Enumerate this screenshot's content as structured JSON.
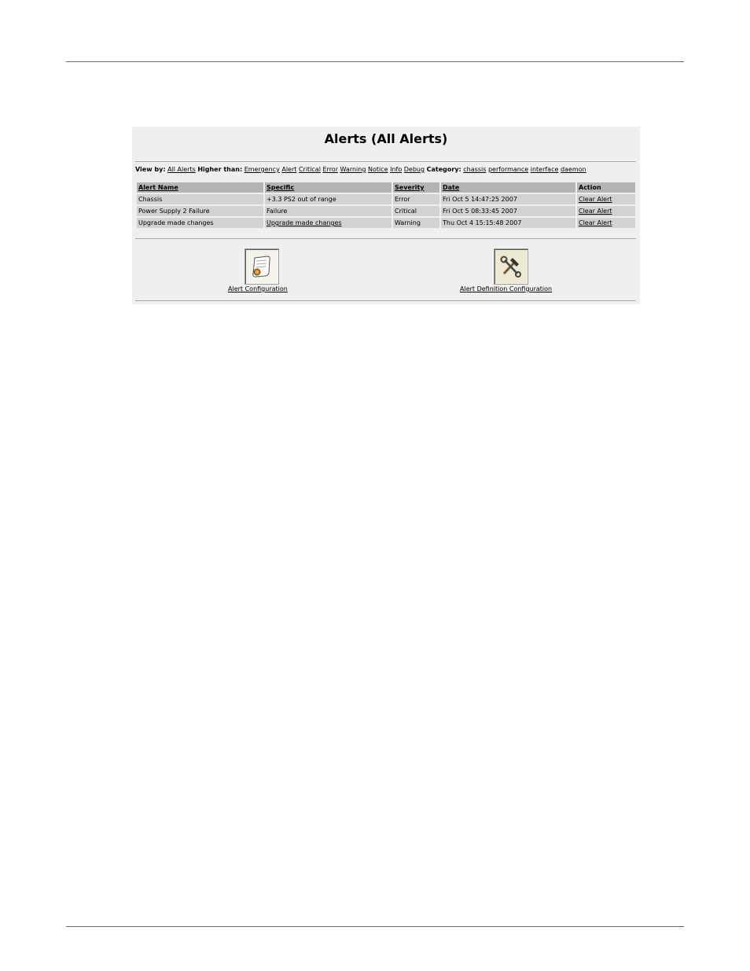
{
  "title": "Alerts (All Alerts)",
  "filters": {
    "view_by_label": "View by:",
    "view_by_all": "All Alerts",
    "higher_than_label": "Higher than:",
    "severities": [
      "Emergency",
      "Alert",
      "Critical",
      "Error",
      "Warning",
      "Notice",
      "Info",
      "Debug"
    ],
    "category_label": "Category:",
    "categories": [
      "chassis",
      "performance",
      "interface",
      "daemon"
    ]
  },
  "table": {
    "headers": [
      "Alert Name",
      "Specific",
      "Severity",
      "Date",
      "Action"
    ],
    "rows": [
      {
        "name": "Chassis",
        "specific": "+3.3 PS2 out of range",
        "severity": "Error",
        "date": "Fri Oct 5 14:47:25 2007",
        "action": "Clear Alert"
      },
      {
        "name": "Power Supply 2 Failure",
        "specific": "Failure",
        "severity": "Critical",
        "date": "Fri Oct 5 08:33:45 2007",
        "action": "Clear Alert"
      },
      {
        "name": "Upgrade made changes",
        "specific": "Upgrade made changes",
        "severity": "Warning",
        "date": "Thu Oct 4 15:15:48 2007",
        "action": "Clear Alert"
      }
    ]
  },
  "links": {
    "alert_configuration": "Alert Configuration",
    "alert_definition_configuration": "Alert Definition Configuration"
  },
  "icons": {
    "alert_configuration": "scroll-document-icon",
    "alert_definition_configuration": "hammer-wrench-icon"
  }
}
